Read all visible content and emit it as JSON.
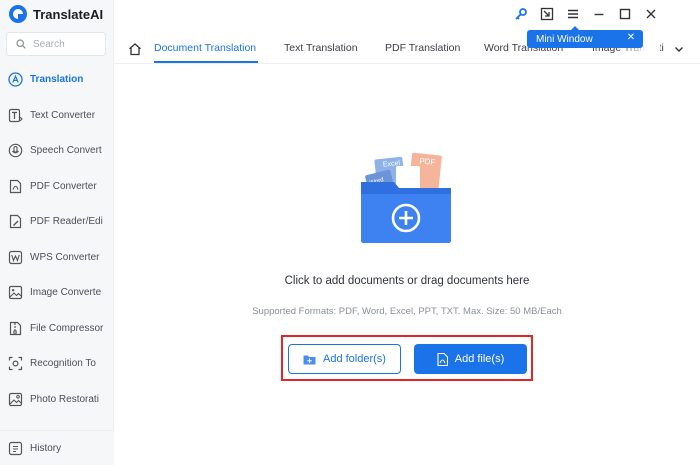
{
  "app": {
    "name": "TranslateAI",
    "accent": "#1a73e8",
    "highlight": "#e3262a"
  },
  "search": {
    "placeholder": "Search",
    "icon": "search-icon"
  },
  "sidebar": {
    "items": [
      {
        "label": "Translation",
        "icon": "translate-icon",
        "active": true
      },
      {
        "label": "Text Converter",
        "icon": "text-icon"
      },
      {
        "label": "Speech Convert",
        "icon": "speech-icon"
      },
      {
        "label": "PDF Converter",
        "icon": "pdf-icon"
      },
      {
        "label": "PDF Reader/Edi",
        "icon": "pdf-reader-icon"
      },
      {
        "label": "WPS Converter",
        "icon": "wps-icon"
      },
      {
        "label": "Image Converte",
        "icon": "image-icon"
      },
      {
        "label": "File Compressor",
        "icon": "compress-icon"
      },
      {
        "label": "Recognition To",
        "icon": "recognition-icon"
      },
      {
        "label": "Photo Restorati",
        "icon": "photo-icon"
      }
    ],
    "history": "History"
  },
  "titlebar": {
    "icons": [
      "key-icon",
      "mini-window-icon",
      "menu-icon",
      "minimize-icon",
      "maximize-icon",
      "close-icon"
    ],
    "tooltip": "Mini Window"
  },
  "tabs": [
    {
      "label": "Document Translation",
      "active": true
    },
    {
      "label": "Text Translation"
    },
    {
      "label": "PDF Translation"
    },
    {
      "label": "Word Translation"
    },
    {
      "label": "Image Translati"
    }
  ],
  "main": {
    "hint": "Click to add documents or drag documents here",
    "formats": "Supported Formats: PDF, Word, Excel, PPT, TXT. Max. Size: 50 MB/Each",
    "art": {
      "excel": "Excel",
      "pdf": "PDF",
      "word": "Word"
    },
    "add_folder": "Add folder(s)",
    "add_file": "Add file(s)"
  }
}
